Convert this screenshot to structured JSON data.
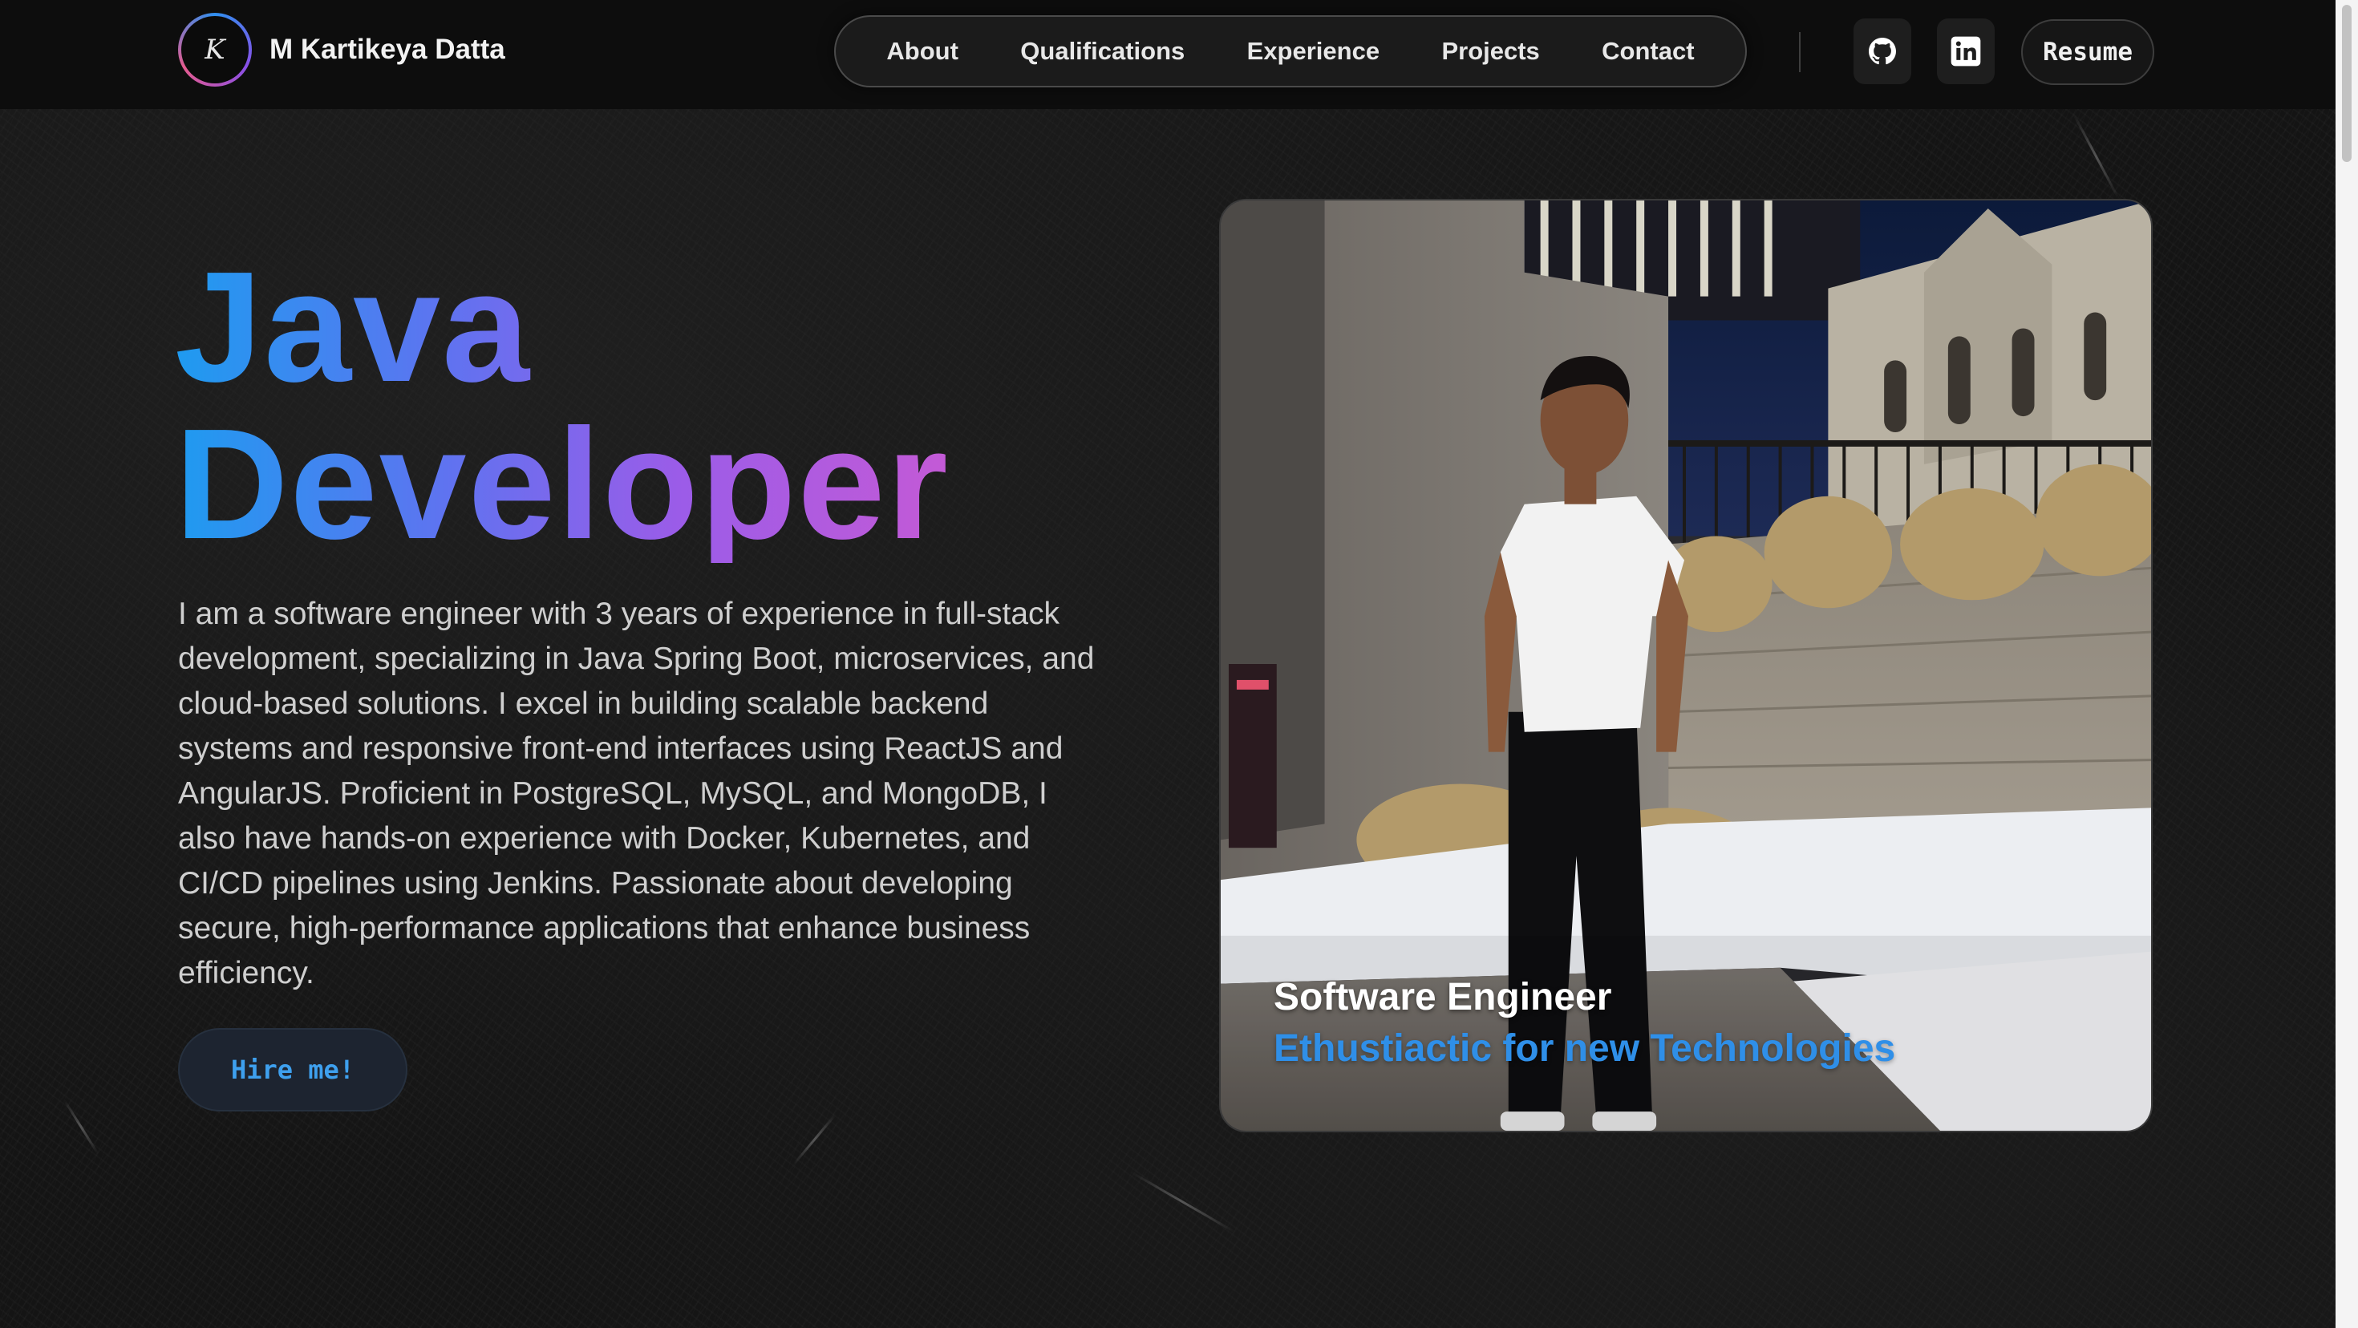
{
  "header": {
    "logo_initials": "K",
    "site_name": "M Kartikeya Datta",
    "nav": [
      {
        "label": "About"
      },
      {
        "label": "Qualifications"
      },
      {
        "label": "Experience"
      },
      {
        "label": "Projects"
      },
      {
        "label": "Contact"
      }
    ],
    "social": [
      {
        "icon": "github-icon"
      },
      {
        "icon": "linkedin-icon"
      }
    ],
    "resume_label": "Resume"
  },
  "hero": {
    "title_line1": "Java",
    "title_line2": "Developer",
    "description": "I am a software engineer with 3 years of experience in full-stack development, specializing in Java Spring Boot, microservices, and cloud-based solutions. I excel in building scalable backend systems and responsive front-end interfaces using ReactJS and AngularJS. Proficient in PostgreSQL, MySQL, and MongoDB, I also have hands-on experience with Docker, Kubernetes, and CI/CD pipelines using Jenkins. Passionate about developing secure, high-performance applications that enhance business efficiency.",
    "hire_label": "Hire me!"
  },
  "photo_card": {
    "caption_title": "Software Engineer",
    "caption_subtitle": "Ethustiactic for new Technologies"
  },
  "colors": {
    "gradient_start": "#1e9bf0",
    "gradient_mid": "#8f5ee9",
    "gradient_end": "#c45ad6",
    "accent_blue": "#2f8fe8",
    "background": "#141414"
  }
}
